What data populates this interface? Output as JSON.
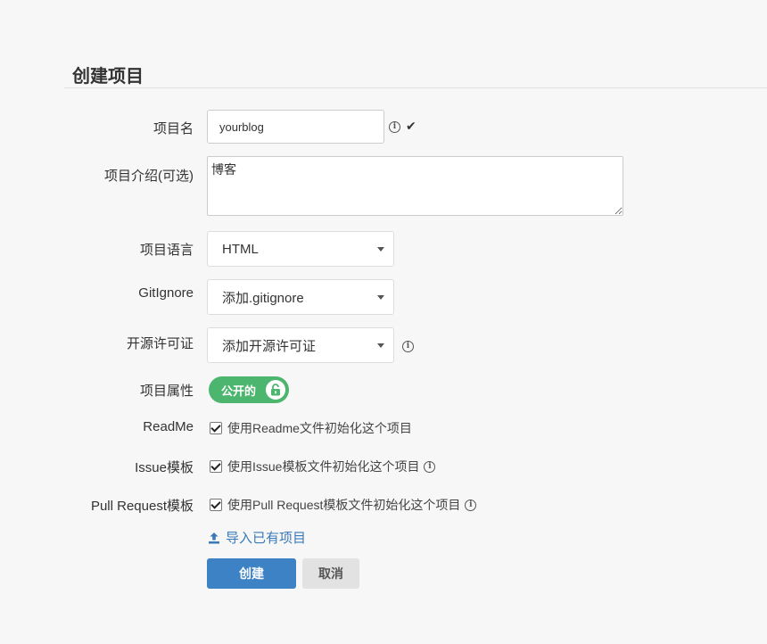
{
  "page": {
    "title": "创建项目"
  },
  "form": {
    "name": {
      "label": "项目名",
      "value": "yourblog",
      "info_icon": "info-icon",
      "status_icon": "check-icon"
    },
    "description": {
      "label": "项目介绍(可选)",
      "value": "博客"
    },
    "language": {
      "label": "项目语言",
      "selected": "HTML"
    },
    "gitignore": {
      "label": "GitIgnore",
      "selected": "添加.gitignore"
    },
    "license": {
      "label": "开源许可证",
      "selected": "添加开源许可证",
      "info_icon": "info-icon"
    },
    "visibility": {
      "label": "项目属性",
      "toggle_label": "公开的",
      "icon": "unlock-icon",
      "color": "#4cb66e"
    },
    "readme": {
      "label": "ReadMe",
      "checkbox_label": "使用Readme文件初始化这个项目",
      "checked": true
    },
    "issue_template": {
      "label": "Issue模板",
      "checkbox_label": "使用Issue模板文件初始化这个项目",
      "checked": true
    },
    "pr_template": {
      "label": "Pull Request模板",
      "checkbox_label": "使用Pull Request模板文件初始化这个项目",
      "checked": true
    },
    "import": {
      "label": "导入已有项目",
      "icon": "upload-icon",
      "color": "#3a79b8"
    }
  },
  "actions": {
    "create_label": "创建",
    "cancel_label": "取消",
    "primary_color": "#3d82c5"
  }
}
